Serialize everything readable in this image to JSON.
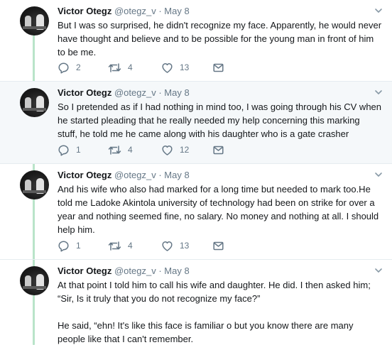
{
  "tweets": [
    {
      "name": "Victor Otegz",
      "handle": "@otegz_v",
      "dot": "·",
      "date": "May 8",
      "paragraphs": [
        "But I was so surprised, he didn't recognize my face. Apparently, he would never have thought and believe and to be possible for the young man in front of him to be me."
      ],
      "replies": "2",
      "retweets": "4",
      "likes": "13"
    },
    {
      "name": "Victor Otegz",
      "handle": "@otegz_v",
      "dot": "·",
      "date": "May 8",
      "paragraphs": [
        "So I pretended as if I had nothing in mind too, I was going through his CV when he started pleading that he really needed my help concerning this marking stuff, he told me he came along with his daughter who is a gate crasher"
      ],
      "replies": "1",
      "retweets": "4",
      "likes": "12"
    },
    {
      "name": "Victor Otegz",
      "handle": "@otegz_v",
      "dot": "·",
      "date": "May 8",
      "paragraphs": [
        "And his wife who also had marked for a long time but needed to mark too.He told me Ladoke Akintola university of technology had been on strike for over a year and nothing seemed fine, no salary. No money and nothing at all. I should help him."
      ],
      "replies": "1",
      "retweets": "4",
      "likes": "13"
    },
    {
      "name": "Victor Otegz",
      "handle": "@otegz_v",
      "dot": "·",
      "date": "May 8",
      "paragraphs": [
        "At that point I told him to call his wife and daughter. He did. I then asked him; “Sir, Is it truly that you do not recognize my face?”",
        "He said, “ehn! It's like this face is familiar o but you know there are many people like that I can't remember."
      ]
    }
  ],
  "colors": {
    "thread_line": "#b9e4c9",
    "highlight_bg": "#f5f8fa",
    "muted": "#657786",
    "text": "#14171a"
  },
  "icons": {
    "reply": "reply-icon",
    "retweet": "retweet-icon",
    "like": "heart-icon",
    "dm": "envelope-icon",
    "caret": "chevron-down-icon"
  }
}
